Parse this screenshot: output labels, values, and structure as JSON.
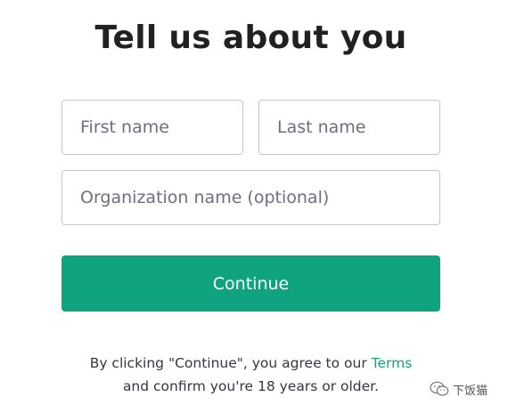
{
  "page": {
    "title": "Tell us about you"
  },
  "form": {
    "first_name": {
      "placeholder": "First name",
      "value": ""
    },
    "last_name": {
      "placeholder": "Last name",
      "value": ""
    },
    "organization": {
      "placeholder": "Organization name (optional)",
      "value": ""
    },
    "continue_label": "Continue"
  },
  "legal": {
    "line1_prefix": "By clicking \"Continue\", you agree to our ",
    "terms_link": "Terms",
    "line2": "and confirm you're 18 years or older."
  },
  "watermark": {
    "text": "下饭猫",
    "icon": "wechat-icon"
  },
  "colors": {
    "accent": "#10a37f",
    "text": "#202123",
    "border": "#c2c8d0",
    "placeholder": "#6e6e80"
  }
}
